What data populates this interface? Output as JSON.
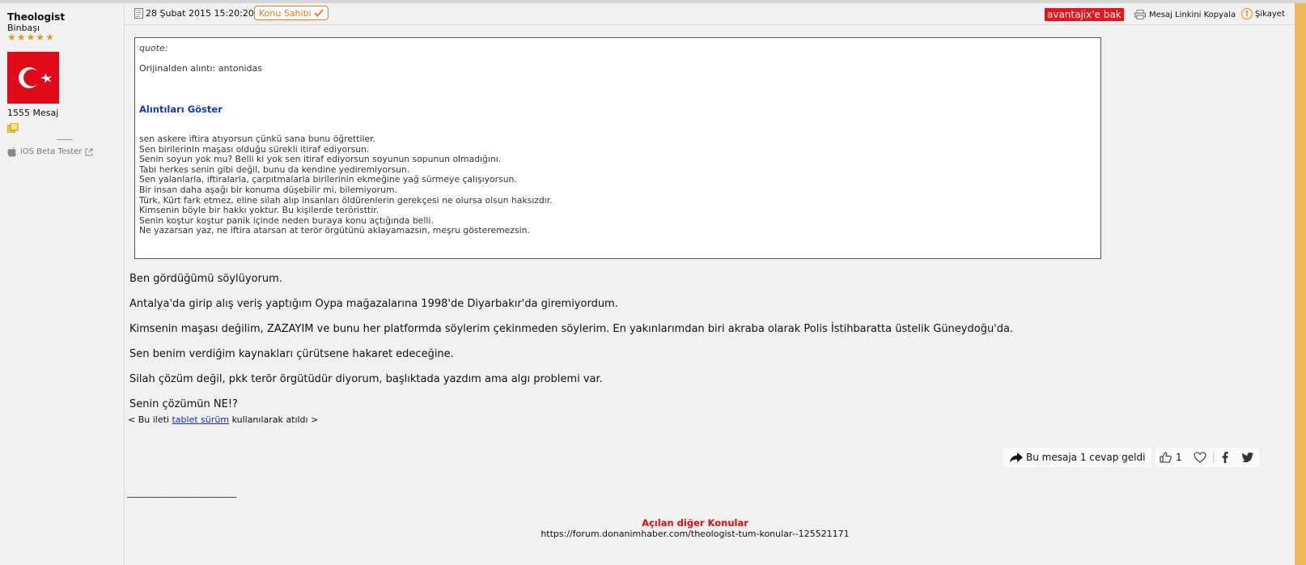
{
  "user": {
    "name": "Theologist",
    "rank": "Binbaşı",
    "stars": [
      "★",
      "★",
      "★",
      "★",
      "★"
    ],
    "message_count": "1555 Mesaj",
    "ios_label": "iOS Beta Tester",
    "avatar_flag_colors": {
      "red": "#e30a17",
      "white": "#ffffff"
    }
  },
  "post_header": {
    "date": "28 Şubat 2015 15:20:20",
    "owner_badge": "Konu Sahibi",
    "advantage_button": "avantajix'e bak",
    "copy_link": "Mesaj Linkini Kopyala",
    "report": "Şikayet"
  },
  "quote": {
    "label": "quote:",
    "original": "Orijinalden alıntı: antonidas",
    "show_quotes": "Alıntıları Göster",
    "lines": [
      "sen askere iftira atıyorsun çünkü sana bunu öğrettiler.",
      "Sen birilerinin maşası olduğu sürekli itiraf ediyorsun.",
      "Senin soyun yok mu? Belli ki yok sen itiraf ediyorsun soyunun sopunun olmadığını.",
      "Tabi herkes senin gibi değil, bunu da kendine yediremiyorsun.",
      "Sen yalanlarla, iftiralarla, çarpıtmalarla birilerinin ekmeğine yağ sürmeye çalışıyorsun.",
      "Bir insan daha aşağı bir konuma düşebilir mi, bilemiyorum.",
      "Türk, Kürt fark etmez, eline silah alıp insanları öldürenlerin gerekçesi ne olursa olsun haksızdır.",
      "Kimsenin böyle bir hakkı yoktur. Bu kişilerde teröristtir.",
      "Senin koştur koştur panik içinde neden buraya konu açtığında belli.",
      "Ne yazarsan yaz, ne iftira atarsan at terör örgütünü aklayamazsın, meşru gösteremezsin."
    ]
  },
  "body": [
    "Ben gördüğümü söylüyorum.",
    "Antalya'da girip alış veriş yaptığım Oypa mağazalarına 1998'de Diyarbakır'da giremiyordum.",
    "Kimsenin maşası değilim, ZAZAYIM ve bunu her platformda söylerim çekinmeden söylerim. En yakınlarımdan biri akraba olarak Polis İstihbaratta üstelik Güneydoğu'da.",
    "Sen benim verdiğim kaynakları çürütsene hakaret edeceğine.",
    "Silah çözüm değil, pkk terör örgütüdür diyorum, başlıktada yazdım ama algı problemi var.",
    "Senin çözümün NE!?"
  ],
  "tablet_note": {
    "prefix": "< Bu ileti ",
    "link": "tablet sürüm",
    "suffix": " kullanılarak atıldı >"
  },
  "reply_info": "Bu mesaja 1 cevap geldi",
  "like_count": "1",
  "signature_line": "___________________________",
  "other_topics": {
    "title": "Açılan diğer Konular",
    "url": "https://forum.donanimhaber.com/theologist-tum-konular--125521171"
  }
}
